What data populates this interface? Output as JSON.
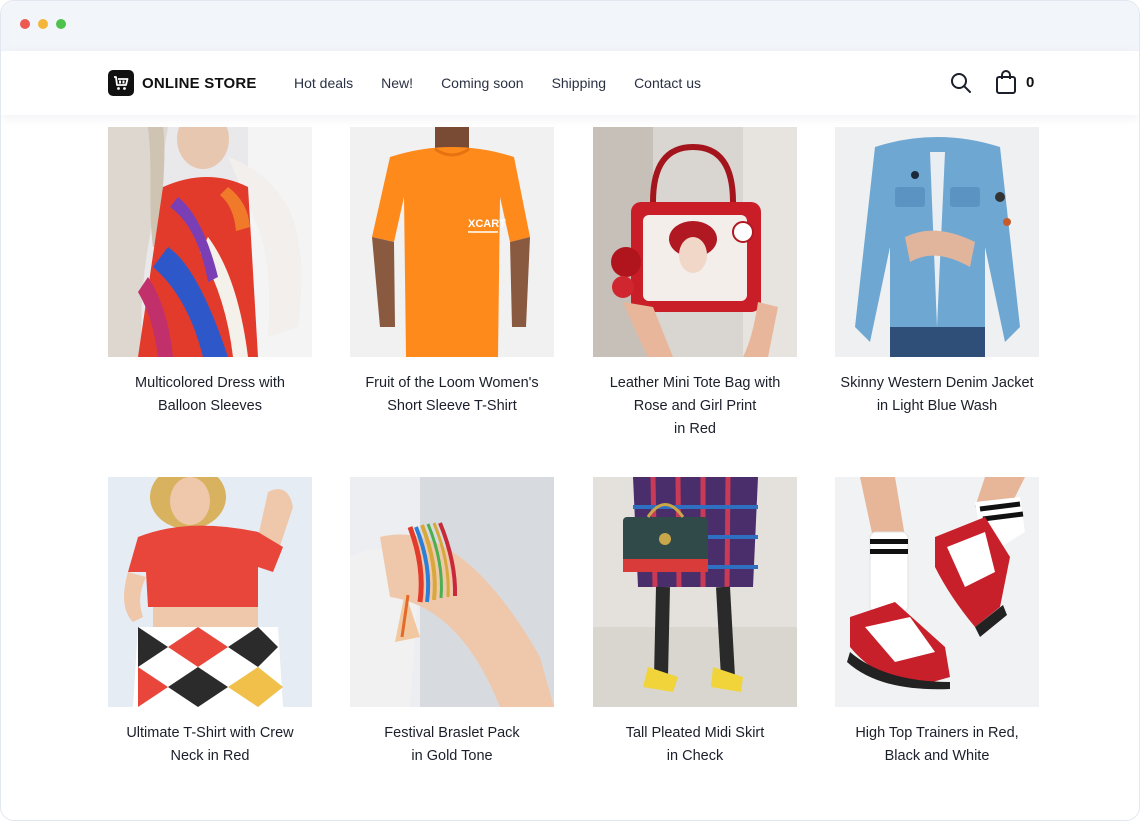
{
  "window": {
    "controls": [
      "close",
      "minimize",
      "maximize"
    ]
  },
  "header": {
    "logo_text": "ONLINE STORE",
    "nav": [
      "Hot deals",
      "New!",
      "Coming soon",
      "Shipping",
      "Contact us"
    ],
    "cart_count": "0"
  },
  "products": [
    {
      "name": "Multicolored Dress with\nBalloon Sleeves",
      "image": "dress-photo"
    },
    {
      "name": "Fruit of the Loom Women's\nShort Sleeve T-Shirt",
      "image": "orange-tshirt-photo"
    },
    {
      "name": "Leather Mini Tote Bag with\nRose and Girl Print\nin Red",
      "image": "red-bag-photo"
    },
    {
      "name": "Skinny Western Denim Jacket\nin Light Blue Wash",
      "image": "denim-jacket-photo"
    },
    {
      "name": "Ultimate T-Shirt with Crew\nNeck in Red",
      "image": "red-tshirt-photo"
    },
    {
      "name": "Festival Braslet Pack\nin Gold Tone",
      "image": "bracelet-photo"
    },
    {
      "name": "Tall Pleated Midi Skirt\nin Check",
      "image": "skirt-photo"
    },
    {
      "name": "High Top Trainers in Red,\nBlack and White",
      "image": "trainers-photo"
    }
  ],
  "colors": {
    "titlebar": "#f2f5fa",
    "accent": "#111111"
  }
}
